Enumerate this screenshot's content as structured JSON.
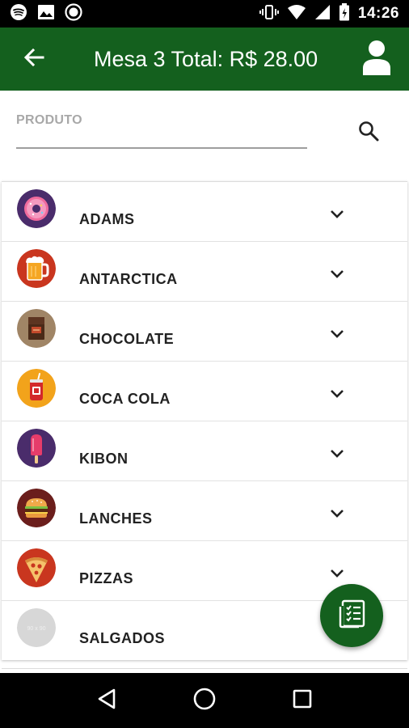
{
  "status_bar": {
    "time": "14:26",
    "left_icons": [
      "spotify-icon",
      "image-icon",
      "record-icon"
    ],
    "right_icons": [
      "vibrate-icon",
      "wifi-icon",
      "signal-icon",
      "battery-icon"
    ]
  },
  "app_bar": {
    "title": "Mesa 3 Total: R$ 28.00",
    "back_icon": "arrow-back-icon",
    "profile_icon": "person-icon",
    "color": "#14601e"
  },
  "search": {
    "label": "PRODUTO",
    "value": "",
    "icon": "search-icon"
  },
  "categories": [
    {
      "label": "ADAMS",
      "icon": "donut-icon",
      "color": "#4a2c6b"
    },
    {
      "label": "ANTARCTICA",
      "icon": "beer-mug-icon",
      "color": "#c9361f"
    },
    {
      "label": "CHOCOLATE",
      "icon": "chocolate-bar-icon",
      "color": "#a08566"
    },
    {
      "label": "COCA COLA",
      "icon": "soda-can-icon",
      "color": "#f2a31b"
    },
    {
      "label": "KIBON",
      "icon": "popsicle-icon",
      "color": "#4a2c6b"
    },
    {
      "label": "LANCHES",
      "icon": "burger-icon",
      "color": "#6b1e1c"
    },
    {
      "label": "PIZZAS",
      "icon": "pizza-slice-icon",
      "color": "#c9361f"
    },
    {
      "label": "SALGADOS",
      "icon": "placeholder-image-icon",
      "color": "#d7d7d7",
      "placeholder_text": "90 x 90"
    }
  ],
  "fab": {
    "icon": "checklist-icon",
    "color": "#14601e"
  },
  "nav_bar": {
    "icons": [
      "back-triangle-icon",
      "home-circle-icon",
      "recents-square-icon"
    ]
  }
}
